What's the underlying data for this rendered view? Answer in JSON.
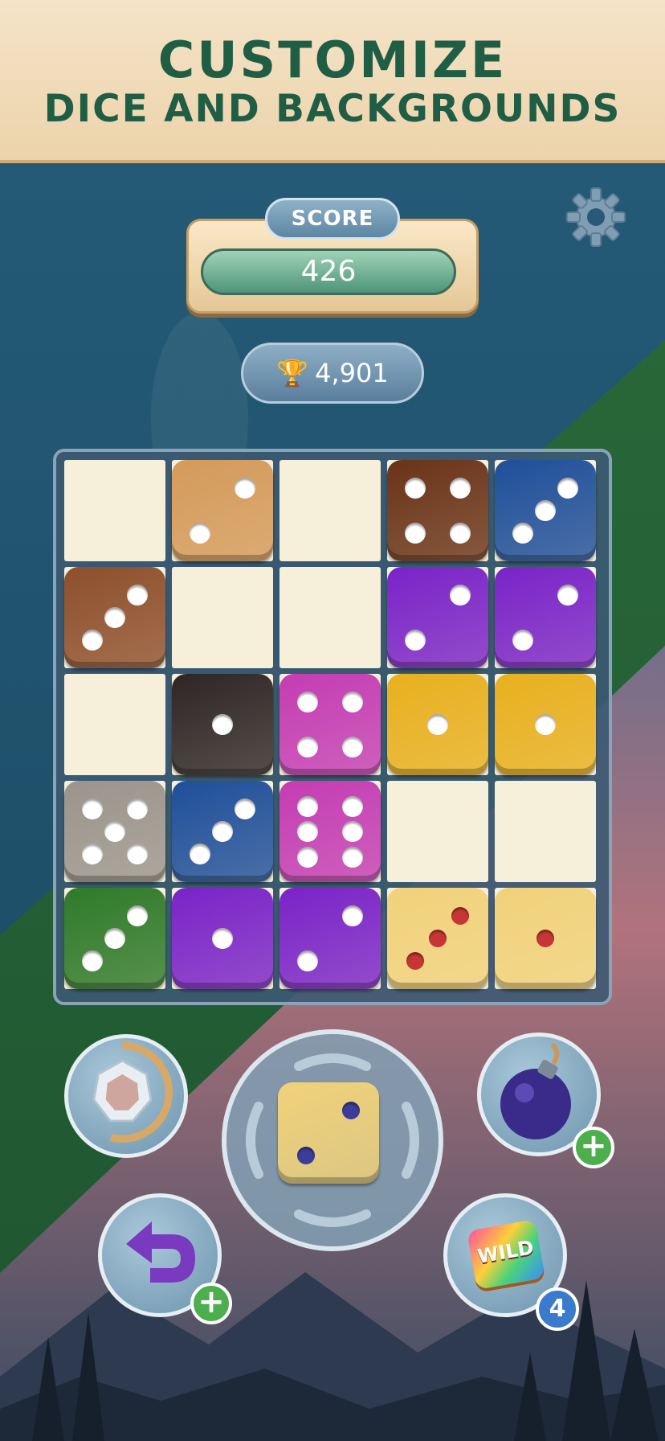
{
  "banner": {
    "line1": "CUSTOMIZE",
    "line2": "DICE AND BACKGROUNDS"
  },
  "score": {
    "label": "SCORE",
    "value": "426"
  },
  "best_score": {
    "value": "4,901",
    "icon": "trophy-icon"
  },
  "board": {
    "rows": 5,
    "cols": 5,
    "dice": [
      {
        "row": 0,
        "col": 1,
        "value": 2,
        "skin": "light-wood"
      },
      {
        "row": 0,
        "col": 3,
        "value": 4,
        "skin": "dark-wood"
      },
      {
        "row": 0,
        "col": 4,
        "value": 3,
        "skin": "blue-fur"
      },
      {
        "row": 1,
        "col": 0,
        "value": 3,
        "skin": "walnut-wood"
      },
      {
        "row": 1,
        "col": 3,
        "value": 2,
        "skin": "purple-fur"
      },
      {
        "row": 1,
        "col": 4,
        "value": 2,
        "skin": "purple-fur"
      },
      {
        "row": 2,
        "col": 1,
        "value": 1,
        "skin": "ebony-wood"
      },
      {
        "row": 2,
        "col": 2,
        "value": 4,
        "skin": "pink-fur"
      },
      {
        "row": 2,
        "col": 3,
        "value": 1,
        "skin": "yellow-fur"
      },
      {
        "row": 2,
        "col": 4,
        "value": 1,
        "skin": "yellow-fur"
      },
      {
        "row": 3,
        "col": 0,
        "value": 5,
        "skin": "grey-wood"
      },
      {
        "row": 3,
        "col": 1,
        "value": 3,
        "skin": "blue-fur"
      },
      {
        "row": 3,
        "col": 2,
        "value": 6,
        "skin": "pink-fur"
      },
      {
        "row": 4,
        "col": 0,
        "value": 3,
        "skin": "green-fur"
      },
      {
        "row": 4,
        "col": 1,
        "value": 1,
        "skin": "purple-fur"
      },
      {
        "row": 4,
        "col": 2,
        "value": 2,
        "skin": "purple-fur"
      },
      {
        "row": 4,
        "col": 3,
        "value": 3,
        "skin": "gold-striped"
      },
      {
        "row": 4,
        "col": 4,
        "value": 1,
        "skin": "gold-striped"
      }
    ]
  },
  "skins": {
    "light-wood": {
      "color": "#d49a5a",
      "pip": "white"
    },
    "dark-wood": {
      "color": "#6a3318",
      "pip": "white"
    },
    "walnut-wood": {
      "color": "#8e4f2c",
      "pip": "white"
    },
    "ebony-wood": {
      "color": "#2e2626",
      "pip": "white"
    },
    "grey-wood": {
      "color": "#9a948c",
      "pip": "white"
    },
    "blue-fur": {
      "color": "#1f4f9a",
      "pip": "white"
    },
    "purple-fur": {
      "color": "#7a23c8",
      "pip": "white"
    },
    "pink-fur": {
      "color": "#c43cb4",
      "pip": "white"
    },
    "yellow-fur": {
      "color": "#e8b01e",
      "pip": "white"
    },
    "green-fur": {
      "color": "#2f7a2a",
      "pip": "white"
    },
    "gold-striped": {
      "color": "#f1d27a",
      "pip": "red"
    }
  },
  "next_die": {
    "value": 2,
    "skin": "gold-striped",
    "pip": "blue"
  },
  "powerups": {
    "gem": {
      "icon": "gem-icon"
    },
    "bomb": {
      "icon": "bomb-icon",
      "add": "+"
    },
    "undo": {
      "icon": "undo-icon",
      "add": "+"
    },
    "wild": {
      "label": "WILD",
      "count": "4"
    }
  },
  "colors": {
    "banner_text": "#1f5e44",
    "blue_bg": "#245a76",
    "green_bg": "#2a6a3a",
    "plus_green": "#4cae4c",
    "badge_blue": "#3a7bcc"
  }
}
